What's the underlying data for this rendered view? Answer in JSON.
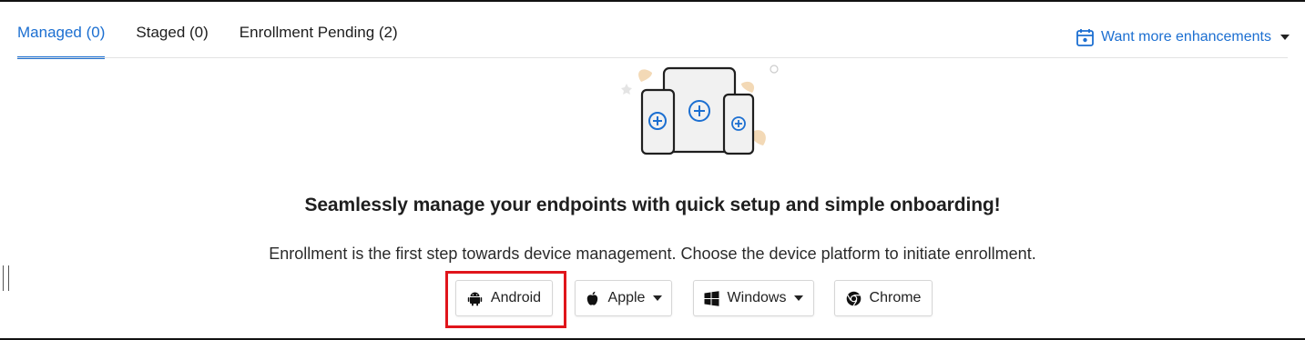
{
  "tabs": [
    {
      "label": "Managed (0)",
      "active": true
    },
    {
      "label": "Staged (0)",
      "active": false
    },
    {
      "label": "Enrollment Pending (2)",
      "active": false
    }
  ],
  "enhancements": {
    "label": "Want more enhancements",
    "icon": "calendar-icon"
  },
  "headline": "Seamlessly manage your endpoints with quick setup and simple onboarding!",
  "subline": "Enrollment is the first step towards device management. Choose the device platform to initiate enrollment.",
  "platforms": [
    {
      "label": "Android",
      "icon": "android-icon",
      "dropdown": false,
      "highlighted": true
    },
    {
      "label": "Apple",
      "icon": "apple-icon",
      "dropdown": true,
      "highlighted": false
    },
    {
      "label": "Windows",
      "icon": "windows-icon",
      "dropdown": true,
      "highlighted": false
    },
    {
      "label": "Chrome",
      "icon": "chrome-icon",
      "dropdown": false,
      "highlighted": false
    }
  ],
  "colors": {
    "accent": "#1c6fd1",
    "highlight": "#e0151b"
  }
}
